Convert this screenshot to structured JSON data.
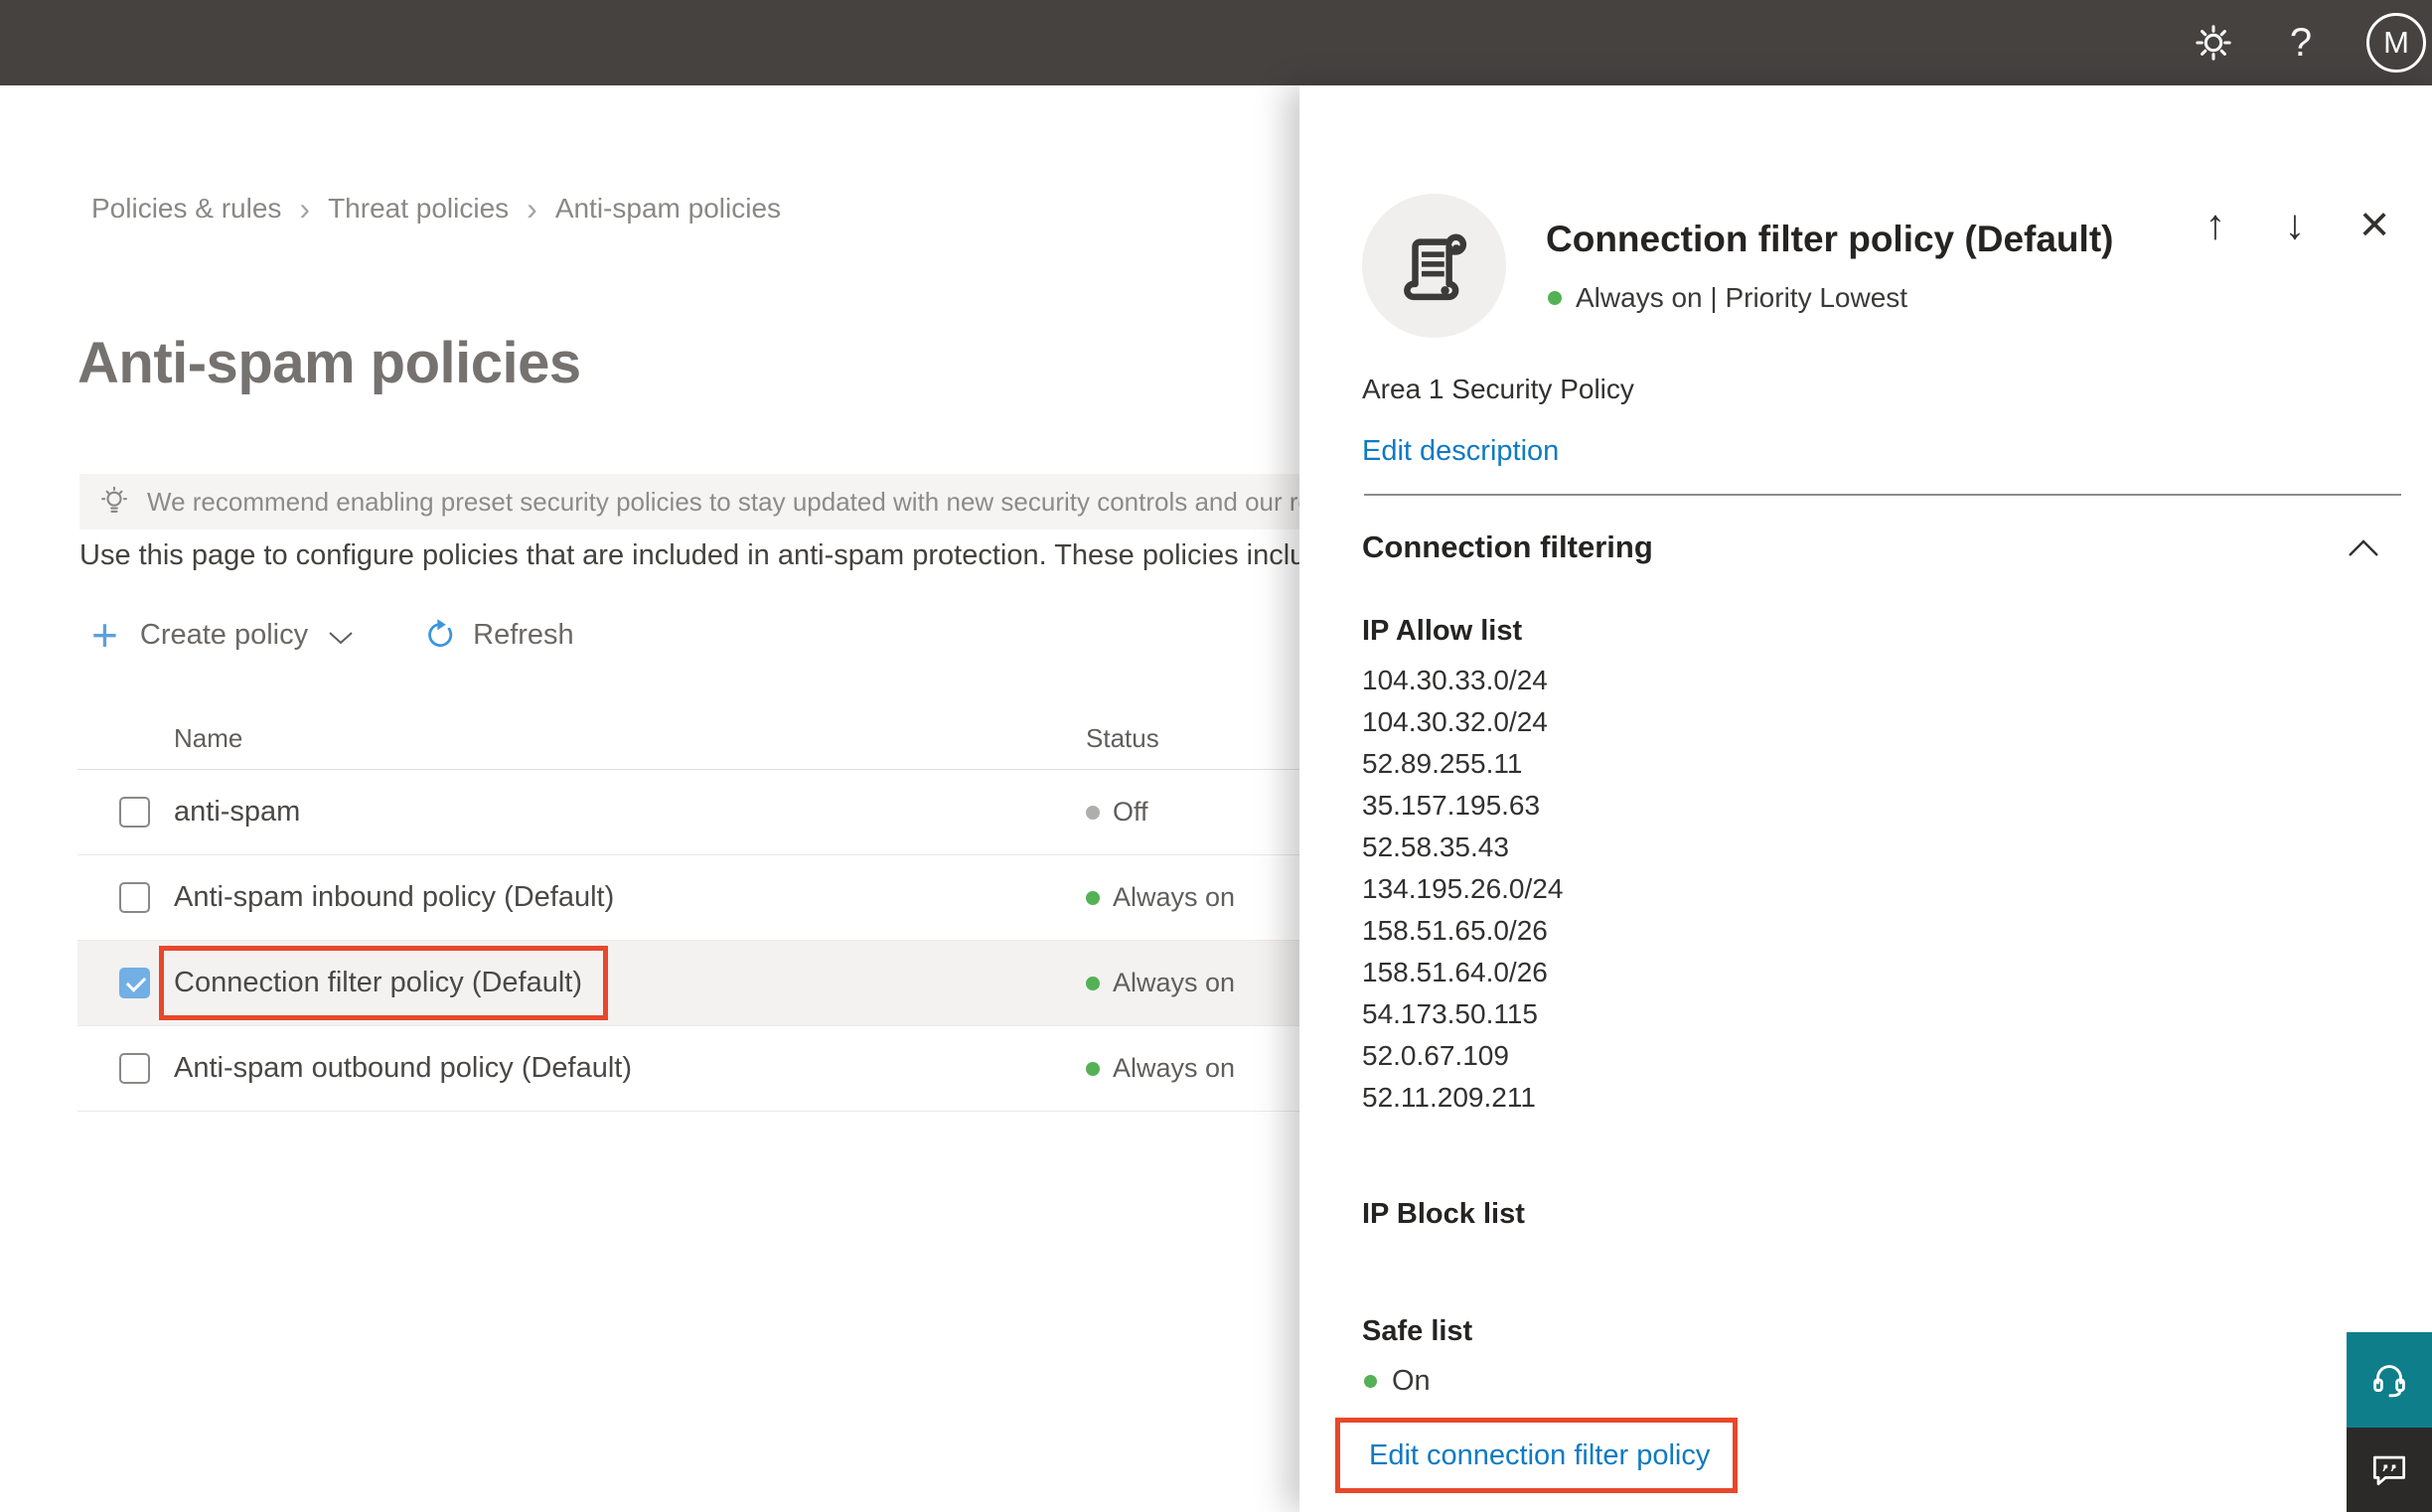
{
  "topbar": {
    "help_label": "?",
    "avatar_initial": "M"
  },
  "breadcrumb": {
    "separator": "›",
    "items": [
      "Policies & rules",
      "Threat policies",
      "Anti-spam policies"
    ]
  },
  "page": {
    "title": "Anti-spam policies",
    "banner_text": "We recommend enabling preset security policies to stay updated with new security controls and our recomme",
    "intro_text": "Use this page to configure policies that are included in anti-spam protection. These policies include"
  },
  "toolbar": {
    "plus_glyph": "+",
    "create_label": "Create policy",
    "refresh_label": "Refresh"
  },
  "table": {
    "columns": [
      "Name",
      "Status"
    ],
    "rows": [
      {
        "name": "anti-spam",
        "status": "Off",
        "state": "off",
        "checked": false,
        "highlighted": false
      },
      {
        "name": "Anti-spam inbound policy (Default)",
        "status": "Always on",
        "state": "on",
        "checked": false,
        "highlighted": false
      },
      {
        "name": "Connection filter policy (Default)",
        "status": "Always on",
        "state": "on",
        "checked": true,
        "highlighted": true
      },
      {
        "name": "Anti-spam outbound policy (Default)",
        "status": "Always on",
        "state": "on",
        "checked": false,
        "highlighted": false
      }
    ]
  },
  "flyout": {
    "nav": {
      "up_glyph": "↑",
      "down_glyph": "↓",
      "close_glyph": "×"
    },
    "title": "Connection filter policy (Default)",
    "status_line": "Always on | Priority Lowest",
    "description": "Area 1 Security Policy",
    "edit_description_label": "Edit description",
    "section_title": "Connection filtering",
    "ip_allow_label": "IP Allow list",
    "ip_allow": [
      "104.30.33.0/24",
      "104.30.32.0/24",
      "52.89.255.11",
      "35.157.195.63",
      "52.58.35.43",
      "134.195.26.0/24",
      "158.51.65.0/26",
      "158.51.64.0/26",
      "54.173.50.115",
      "52.0.67.109",
      "52.11.209.211"
    ],
    "ip_block_label": "IP Block list",
    "safe_list_label": "Safe list",
    "safe_list_value": "On",
    "edit_link_label": "Edit connection filter policy"
  },
  "colors": {
    "topbar_bg": "#454240",
    "title_gray": "#757270",
    "link_blue": "#0f7ac3",
    "checkbox_blue": "#71afe5",
    "status_on_green": "#55b155",
    "status_off_gray": "#b0aeac",
    "highlight_red": "#e8472b",
    "selected_row_bg": "#f3f2f1",
    "support_teal": "#0f7e8b",
    "feedback_dark": "#2b2a28",
    "banner_bg": "#f5f4f3"
  }
}
